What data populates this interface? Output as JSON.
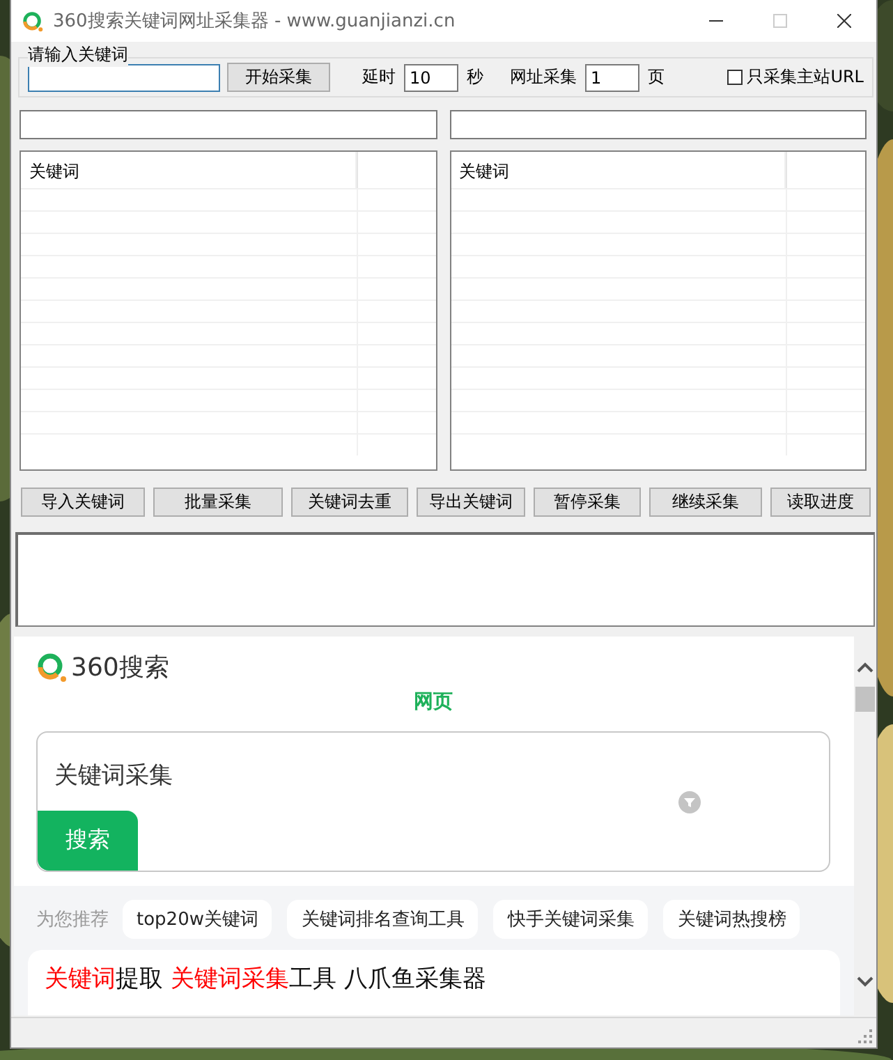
{
  "window": {
    "title": "360搜索关键词网址采集器 - www.guanjianzi.cn",
    "controls": [
      {
        "kind": "minimize",
        "disabled": false
      },
      {
        "kind": "maximize",
        "disabled": true
      },
      {
        "kind": "close",
        "disabled": false
      }
    ]
  },
  "input_group": {
    "label": "请输入关键词",
    "start_button": "开始采集",
    "delay_label": "延时",
    "delay_value": "10",
    "delay_unit": "秒",
    "pages_label": "网址采集",
    "pages_value": "1",
    "pages_unit": "页",
    "main_site_only": {
      "label": "只采集主站URL",
      "checked": false
    }
  },
  "lists": [
    {
      "header": "关键词"
    },
    {
      "header": "关键词"
    }
  ],
  "buttons": [
    "导入关键词",
    "批量采集",
    "关键词去重",
    "导出关键词",
    "暂停采集",
    "继续采集",
    "读取进度"
  ],
  "browser": {
    "logo_text": "360搜索",
    "tab": "网页",
    "query": "关键词采集",
    "search_button": "搜索",
    "recommend_label": "为您推荐",
    "recommendations": [
      "top20w关键词",
      "关键词排名查询工具",
      "快手关键词采集",
      "关键词热搜榜"
    ],
    "result_title": [
      {
        "text": "关键词",
        "highlight": true
      },
      {
        "text": "提取 ",
        "highlight": false
      },
      {
        "text": "关键词采集",
        "highlight": true
      },
      {
        "text": "工具 八爪鱼采集器",
        "highlight": false
      }
    ]
  }
}
